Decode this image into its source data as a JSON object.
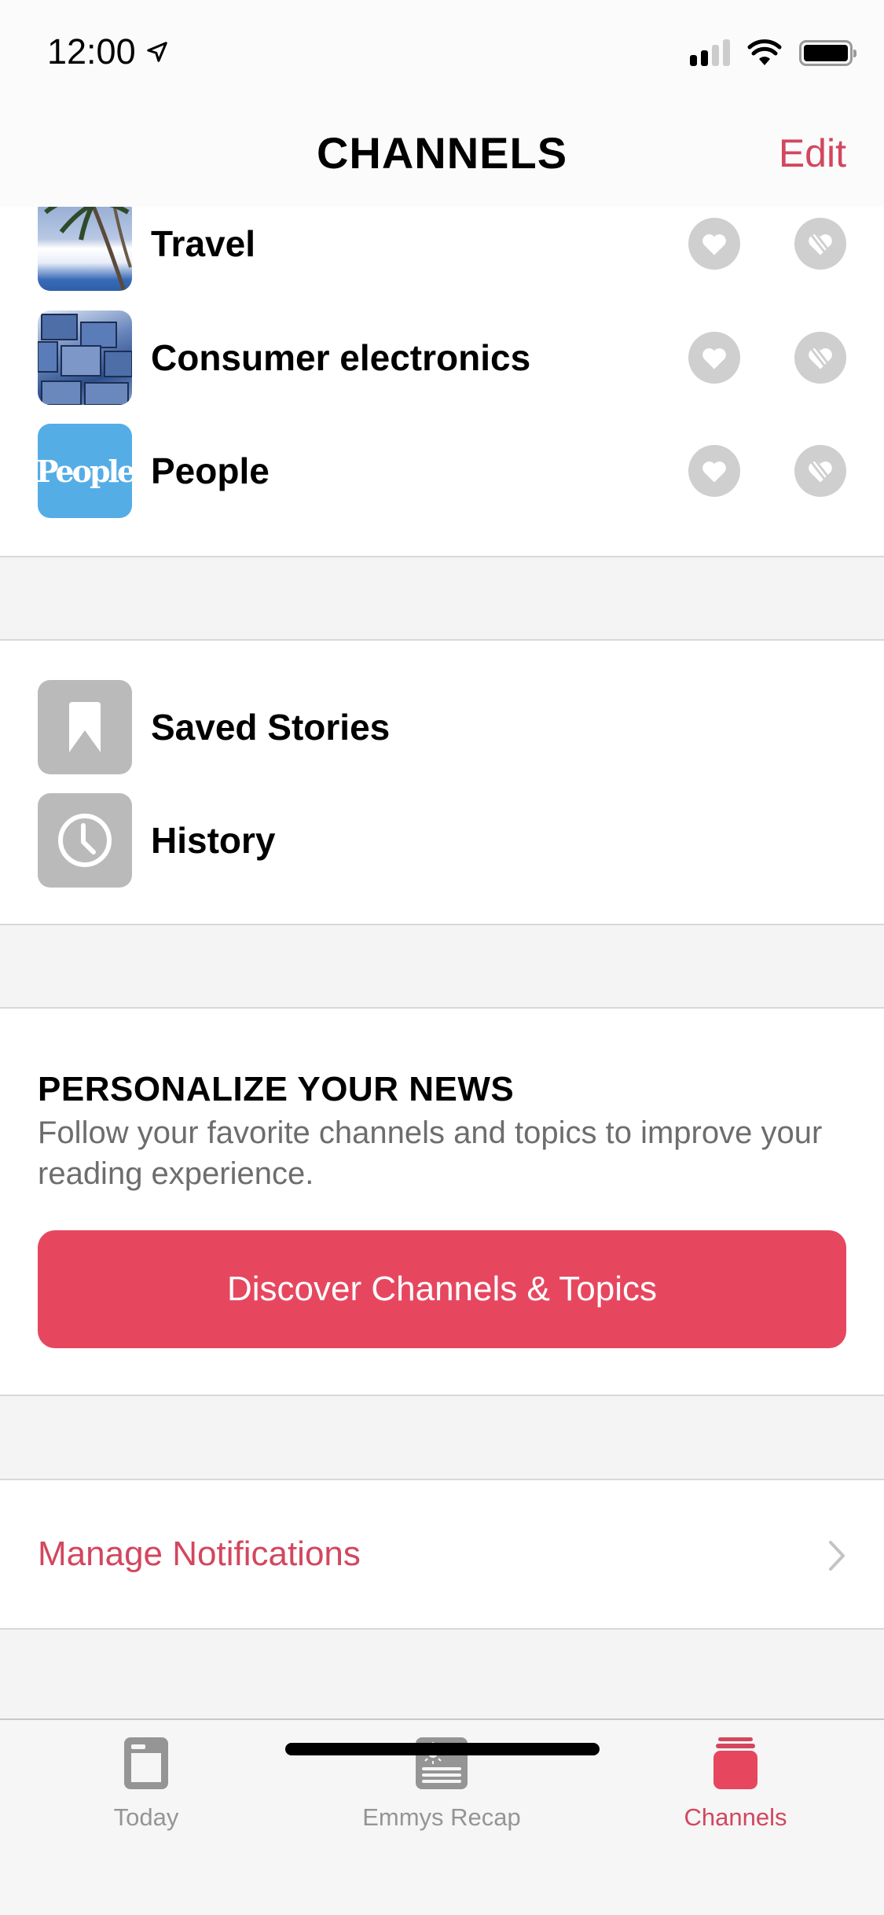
{
  "status_bar": {
    "time": "12:00",
    "location_icon": "location-arrow-icon",
    "signal_bars_active": 2,
    "signal_bars_total": 4,
    "wifi_icon": "wifi-icon",
    "battery_level": 1.0
  },
  "nav": {
    "title": "CHANNELS",
    "edit_label": "Edit"
  },
  "channels": [
    {
      "label": "Travel",
      "thumb": "travel-thumbnail"
    },
    {
      "label": "Consumer electronics",
      "thumb": "electronics-thumbnail"
    },
    {
      "label": "People",
      "thumb": "people-logo",
      "logo_text": "People"
    }
  ],
  "library": [
    {
      "label": "Saved Stories",
      "icon": "bookmark-icon"
    },
    {
      "label": "History",
      "icon": "clock-icon"
    }
  ],
  "personalize": {
    "title": "PERSONALIZE YOUR NEWS",
    "description": "Follow your favorite channels and topics to improve your reading experience.",
    "button_label": "Discover Channels & Topics"
  },
  "notifications": {
    "label": "Manage Notifications"
  },
  "tabbar": {
    "tabs": [
      {
        "label": "Today",
        "icon": "today-icon",
        "active": false
      },
      {
        "label": "Emmys Recap",
        "icon": "emmys-recap-icon",
        "active": false
      },
      {
        "label": "Channels",
        "icon": "channels-icon",
        "active": true
      }
    ]
  },
  "colors": {
    "accent": "#e6475f",
    "accent_text": "#d2475e",
    "icon_gray": "#bababa",
    "tab_inactive": "#959595"
  }
}
